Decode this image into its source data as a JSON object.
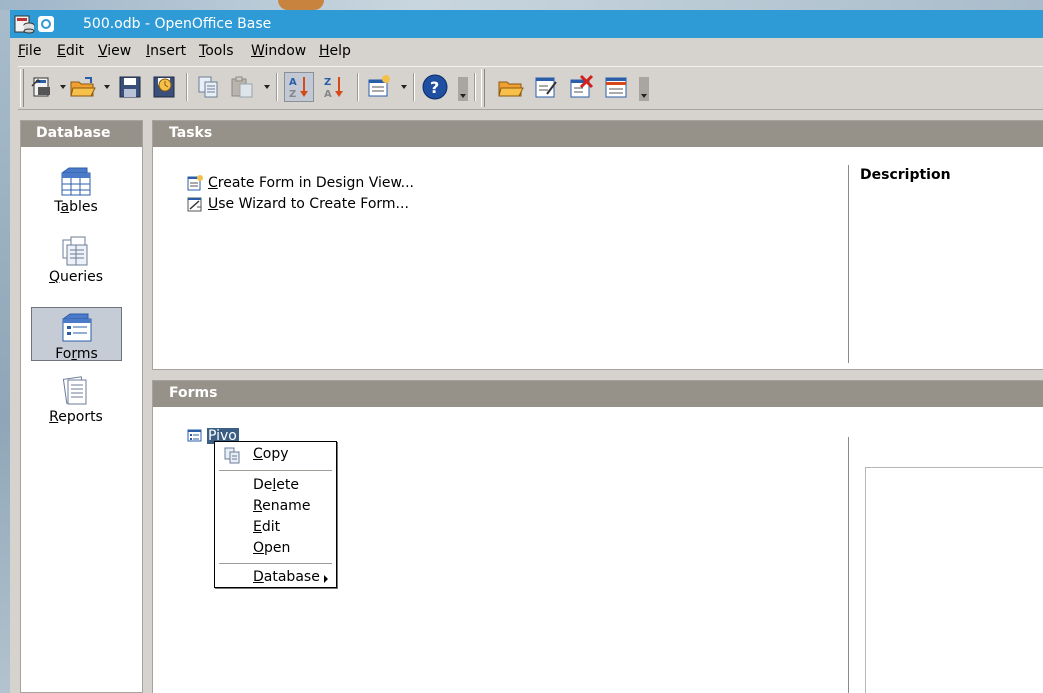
{
  "window": {
    "title": "500.odb - OpenOffice Base"
  },
  "menubar": {
    "items": [
      {
        "label": "File",
        "accel": "F",
        "rest": "ile"
      },
      {
        "label": "Edit",
        "accel": "E",
        "rest": "dit"
      },
      {
        "label": "View",
        "accel": "V",
        "rest": "iew"
      },
      {
        "label": "Insert",
        "accel": "I",
        "rest": "nsert"
      },
      {
        "label": "Tools",
        "accel": "T",
        "rest": "ools"
      },
      {
        "label": "Window",
        "accel": "W",
        "rest": "indow"
      },
      {
        "label": "Help",
        "accel": "H",
        "rest": "elp"
      }
    ]
  },
  "toolbar": {
    "icons": [
      "new-icon",
      "open-icon",
      "save-icon",
      "save-as-icon",
      "copy-icon",
      "paste-icon",
      "sort-ascending-icon",
      "sort-descending-icon",
      "form-wizard-icon",
      "help-icon",
      "open-object-icon",
      "edit-object-icon",
      "delete-object-icon",
      "rename-object-icon"
    ]
  },
  "database_panel": {
    "header": "Database",
    "items": [
      {
        "pre": "T",
        "accel": "a",
        "post": "bles",
        "icon": "tables-icon"
      },
      {
        "pre": "",
        "accel": "Q",
        "post": "ueries",
        "icon": "queries-icon"
      },
      {
        "pre": "Fo",
        "accel": "r",
        "post": "ms",
        "icon": "forms-icon",
        "active": true
      },
      {
        "pre": "",
        "accel": "R",
        "post": "eports",
        "icon": "reports-icon"
      }
    ]
  },
  "tasks_panel": {
    "header": "Tasks",
    "tasks": [
      {
        "accel": "C",
        "rest": "reate Form in Design View...",
        "icon": "form-design-icon"
      },
      {
        "accel": "U",
        "rest": "se Wizard to Create Form...",
        "icon": "form-wizard-task-icon"
      }
    ],
    "description_label": "Description"
  },
  "forms_panel": {
    "header": "Forms",
    "entries": [
      {
        "name": "Pivot",
        "visible_text": "Pivo",
        "icon": "form-document-icon"
      }
    ]
  },
  "context_menu": {
    "items": [
      {
        "pre": "",
        "accel": "C",
        "post": "opy",
        "icon": "copy-icon"
      },
      {
        "pre": "De",
        "accel": "l",
        "post": "ete"
      },
      {
        "pre": "",
        "accel": "R",
        "post": "ename"
      },
      {
        "pre": "",
        "accel": "E",
        "post": "dit"
      },
      {
        "pre": "",
        "accel": "O",
        "post": "pen"
      },
      {
        "pre": "",
        "accel": "D",
        "post": "atabase",
        "submenu": true
      }
    ]
  },
  "colors": {
    "titlebar": "#2f9bd6",
    "panel_header": "#969289",
    "selection": "#3b5f82",
    "active_item": "#c6ccd6"
  }
}
